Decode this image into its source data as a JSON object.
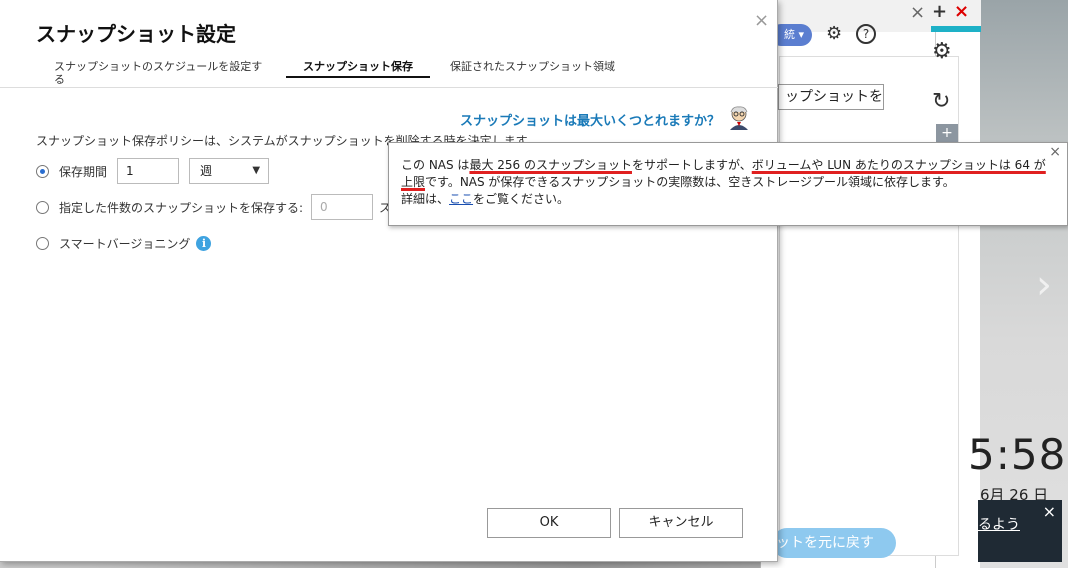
{
  "dialog": {
    "title": "スナップショット設定",
    "close_glyph": "×",
    "tabs": [
      {
        "label": "スナップショットのスケジュールを設定する"
      },
      {
        "label": "スナップショット保存"
      },
      {
        "label": "保証されたスナップショット領域"
      }
    ],
    "help_link": "スナップショットは最大いくつとれますか？",
    "policy_description": "スナップショット保存ポリシーは、システムがスナップショットを削除する時を決定します。",
    "options": {
      "retention_period": {
        "label": "保存期間",
        "value": "1",
        "unit": "週",
        "selected": true
      },
      "keep_count": {
        "label": "指定した件数のスナップショットを保存する:",
        "value": "0",
        "trail": "ス"
      },
      "smart_versioning": {
        "label": "スマートバージョニング",
        "info": "i"
      }
    },
    "buttons": {
      "ok": "OK",
      "cancel": "キャンセル"
    }
  },
  "tooltip": {
    "part1": "この NAS は",
    "part2": "最大 256 のスナップショット",
    "part3": "をサポートしますが、",
    "part4": "ボリュームや LUN あたりのスナップショットは 64 が上限",
    "part5": "です。NAS が保存できるスナップショットの実際数は、空きストレージプール領域に依存します。",
    "part6": "詳細は、",
    "link": "ここ",
    "part7": "をご覧ください。",
    "close_glyph": "×"
  },
  "background": {
    "take_snapshot_button": "ップショットを撮る",
    "restore_button": "ットを元に戻す",
    "pill_text": "統",
    "clock": "5:58",
    "date": "6月 26 日",
    "notification": "るよう"
  },
  "colors": {
    "accent": "#1a7ab8",
    "underline_red": "#e02020",
    "teal": "#1eb1c7"
  }
}
